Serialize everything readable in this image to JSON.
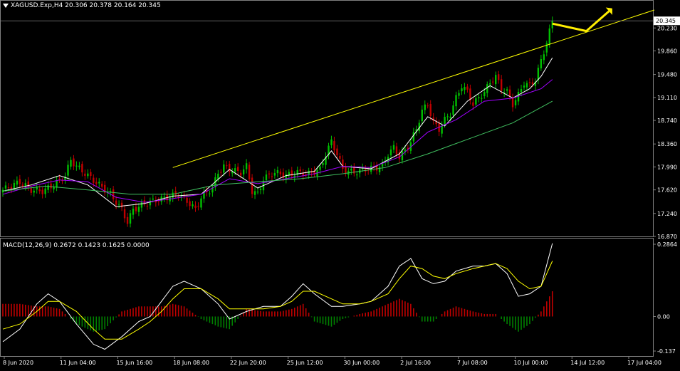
{
  "price_panel": {
    "symbol_line": "XAGUSD.Exp,H4  20.306 20.378 20.164 20.345",
    "last_price_label": "20.345"
  },
  "macd_panel": {
    "title": "MACD(12,26,9) 0.2672 0.1423 0.1625 0.0000"
  },
  "x_axis_labels": [
    "8 Jun 2020",
    "11 Jun 04:00",
    "15 Jun 16:00",
    "18 Jun 08:00",
    "22 Jun 20:00",
    "25 Jun 12:00",
    "30 Jun 00:00",
    "2 Jul 16:00",
    "7 Jul 08:00",
    "10 Jul 00:00",
    "14 Jul 12:00",
    "17 Jul 04:00"
  ],
  "colors": {
    "background": "#000000",
    "bull_candle": "#00c000",
    "bear_candle": "#c00000",
    "ma_fast": "#ffffff",
    "ma_mid": "#a000ff",
    "ma_slow": "#40c060",
    "trendline": "#ffff00",
    "arrow": "#ffee00",
    "macd_line": "#ffffff",
    "signal_line": "#ffff00",
    "hist_pos": "#c00000",
    "hist_neg": "#008000",
    "grid_text": "#ffffff"
  },
  "chart_data": [
    {
      "type": "candlestick",
      "title": "XAGUSD.Exp,H4",
      "ylim": [
        16.87,
        20.52
      ],
      "y_ticks": [
        "16.870",
        "17.240",
        "17.620",
        "17.990",
        "18.360",
        "18.740",
        "19.110",
        "19.480",
        "19.860",
        "20.230"
      ],
      "last_price": 20.345,
      "close_path": [
        [
          0,
          17.62
        ],
        [
          6,
          17.75
        ],
        [
          10,
          17.62
        ],
        [
          14,
          17.6
        ],
        [
          18,
          17.7
        ],
        [
          22,
          17.85
        ],
        [
          24,
          18.1
        ],
        [
          26,
          18.0
        ],
        [
          30,
          17.85
        ],
        [
          34,
          17.7
        ],
        [
          38,
          17.55
        ],
        [
          42,
          17.3
        ],
        [
          44,
          17.1
        ],
        [
          46,
          17.3
        ],
        [
          50,
          17.4
        ],
        [
          54,
          17.45
        ],
        [
          58,
          17.5
        ],
        [
          62,
          17.55
        ],
        [
          66,
          17.4
        ],
        [
          68,
          17.3
        ],
        [
          70,
          17.5
        ],
        [
          74,
          17.65
        ],
        [
          76,
          17.9
        ],
        [
          78,
          18.0
        ],
        [
          80,
          17.95
        ],
        [
          84,
          17.9
        ],
        [
          86,
          18.0
        ],
        [
          88,
          17.6
        ],
        [
          90,
          17.55
        ],
        [
          92,
          17.8
        ],
        [
          96,
          17.9
        ],
        [
          100,
          17.85
        ],
        [
          104,
          17.9
        ],
        [
          108,
          17.88
        ],
        [
          112,
          17.95
        ],
        [
          114,
          18.2
        ],
        [
          116,
          18.4
        ],
        [
          118,
          18.2
        ],
        [
          120,
          17.95
        ],
        [
          124,
          17.9
        ],
        [
          128,
          17.95
        ],
        [
          132,
          17.98
        ],
        [
          134,
          18.0
        ],
        [
          136,
          18.2
        ],
        [
          138,
          18.3
        ],
        [
          140,
          18.15
        ],
        [
          142,
          18.25
        ],
        [
          144,
          18.4
        ],
        [
          146,
          18.6
        ],
        [
          148,
          18.9
        ],
        [
          150,
          19.0
        ],
        [
          152,
          18.7
        ],
        [
          154,
          18.6
        ],
        [
          156,
          18.75
        ],
        [
          158,
          18.85
        ],
        [
          160,
          19.1
        ],
        [
          162,
          19.3
        ],
        [
          164,
          19.2
        ],
        [
          166,
          19.0
        ],
        [
          168,
          19.1
        ],
        [
          170,
          19.2
        ],
        [
          172,
          19.35
        ],
        [
          174,
          19.45
        ],
        [
          176,
          19.25
        ],
        [
          178,
          19.2
        ],
        [
          180,
          19.0
        ],
        [
          182,
          19.15
        ],
        [
          184,
          19.35
        ],
        [
          186,
          19.3
        ],
        [
          188,
          19.4
        ],
        [
          190,
          19.7
        ],
        [
          192,
          20.0
        ],
        [
          194,
          20.345
        ]
      ],
      "series": [
        {
          "name": "",
          "kind": "ma",
          "color": "#ffffff",
          "points": [
            [
              0,
              17.6
            ],
            [
              10,
              17.7
            ],
            [
              20,
              17.85
            ],
            [
              30,
              17.7
            ],
            [
              40,
              17.35
            ],
            [
              50,
              17.4
            ],
            [
              60,
              17.52
            ],
            [
              70,
              17.55
            ],
            [
              80,
              17.95
            ],
            [
              90,
              17.65
            ],
            [
              100,
              17.85
            ],
            [
              110,
              17.92
            ],
            [
              116,
              18.25
            ],
            [
              120,
              18.0
            ],
            [
              130,
              17.96
            ],
            [
              140,
              18.2
            ],
            [
              150,
              18.8
            ],
            [
              156,
              18.65
            ],
            [
              164,
              19.05
            ],
            [
              172,
              19.3
            ],
            [
              180,
              19.1
            ],
            [
              186,
              19.25
            ],
            [
              190,
              19.45
            ],
            [
              194,
              19.75
            ]
          ]
        },
        {
          "name": "",
          "kind": "ma",
          "color": "#a000ff",
          "points": [
            [
              0,
              17.55
            ],
            [
              10,
              17.68
            ],
            [
              20,
              17.78
            ],
            [
              30,
              17.75
            ],
            [
              40,
              17.5
            ],
            [
              50,
              17.42
            ],
            [
              60,
              17.48
            ],
            [
              70,
              17.55
            ],
            [
              80,
              17.8
            ],
            [
              90,
              17.72
            ],
            [
              100,
              17.8
            ],
            [
              110,
              17.88
            ],
            [
              120,
              18.0
            ],
            [
              130,
              17.98
            ],
            [
              140,
              18.15
            ],
            [
              150,
              18.55
            ],
            [
              160,
              18.75
            ],
            [
              170,
              19.05
            ],
            [
              180,
              19.1
            ],
            [
              190,
              19.25
            ],
            [
              194,
              19.4
            ]
          ]
        },
        {
          "name": "",
          "kind": "ma",
          "color": "#40c060",
          "points": [
            [
              0,
              17.6
            ],
            [
              15,
              17.68
            ],
            [
              30,
              17.62
            ],
            [
              45,
              17.55
            ],
            [
              60,
              17.55
            ],
            [
              75,
              17.7
            ],
            [
              90,
              17.75
            ],
            [
              105,
              17.8
            ],
            [
              120,
              17.88
            ],
            [
              135,
              17.98
            ],
            [
              150,
              18.2
            ],
            [
              165,
              18.45
            ],
            [
              180,
              18.7
            ],
            [
              194,
              19.05
            ]
          ]
        }
      ],
      "trendline": [
        [
          60,
          17.98
        ],
        [
          230,
          20.52
        ]
      ],
      "annotation_arrow": [
        [
          194,
          20.3
        ],
        [
          206,
          20.18
        ],
        [
          214,
          20.5
        ]
      ]
    },
    {
      "type": "bar",
      "title": "MACD(12,26,9)",
      "ylim": [
        -0.137,
        0.2864
      ],
      "y_ticks": [
        "0.2864",
        "0.00",
        "-0.137"
      ],
      "macd_line": [
        [
          0,
          -0.1
        ],
        [
          6,
          -0.05
        ],
        [
          12,
          0.05
        ],
        [
          16,
          0.09
        ],
        [
          20,
          0.06
        ],
        [
          26,
          -0.03
        ],
        [
          32,
          -0.11
        ],
        [
          36,
          -0.13
        ],
        [
          42,
          -0.08
        ],
        [
          48,
          -0.02
        ],
        [
          52,
          0.0
        ],
        [
          56,
          0.06
        ],
        [
          60,
          0.12
        ],
        [
          64,
          0.14
        ],
        [
          70,
          0.11
        ],
        [
          76,
          0.05
        ],
        [
          80,
          -0.01
        ],
        [
          86,
          0.02
        ],
        [
          92,
          0.04
        ],
        [
          98,
          0.04
        ],
        [
          102,
          0.08
        ],
        [
          106,
          0.13
        ],
        [
          110,
          0.09
        ],
        [
          116,
          0.04
        ],
        [
          120,
          0.04
        ],
        [
          126,
          0.05
        ],
        [
          130,
          0.06
        ],
        [
          136,
          0.12
        ],
        [
          140,
          0.2
        ],
        [
          144,
          0.23
        ],
        [
          148,
          0.15
        ],
        [
          152,
          0.13
        ],
        [
          156,
          0.14
        ],
        [
          160,
          0.18
        ],
        [
          166,
          0.2
        ],
        [
          170,
          0.2
        ],
        [
          174,
          0.21
        ],
        [
          178,
          0.17
        ],
        [
          182,
          0.08
        ],
        [
          186,
          0.09
        ],
        [
          190,
          0.12
        ],
        [
          194,
          0.29
        ]
      ],
      "signal_line": [
        [
          0,
          -0.05
        ],
        [
          6,
          -0.03
        ],
        [
          12,
          0.02
        ],
        [
          16,
          0.06
        ],
        [
          20,
          0.06
        ],
        [
          26,
          0.02
        ],
        [
          32,
          -0.05
        ],
        [
          36,
          -0.09
        ],
        [
          42,
          -0.09
        ],
        [
          48,
          -0.05
        ],
        [
          52,
          -0.02
        ],
        [
          56,
          0.02
        ],
        [
          60,
          0.07
        ],
        [
          64,
          0.11
        ],
        [
          70,
          0.11
        ],
        [
          76,
          0.07
        ],
        [
          80,
          0.03
        ],
        [
          86,
          0.03
        ],
        [
          92,
          0.03
        ],
        [
          98,
          0.04
        ],
        [
          102,
          0.06
        ],
        [
          106,
          0.1
        ],
        [
          110,
          0.1
        ],
        [
          116,
          0.07
        ],
        [
          120,
          0.05
        ],
        [
          126,
          0.05
        ],
        [
          130,
          0.06
        ],
        [
          136,
          0.09
        ],
        [
          140,
          0.15
        ],
        [
          144,
          0.2
        ],
        [
          148,
          0.19
        ],
        [
          152,
          0.16
        ],
        [
          156,
          0.15
        ],
        [
          160,
          0.17
        ],
        [
          166,
          0.19
        ],
        [
          170,
          0.2
        ],
        [
          174,
          0.21
        ],
        [
          178,
          0.19
        ],
        [
          182,
          0.14
        ],
        [
          186,
          0.11
        ],
        [
          190,
          0.12
        ],
        [
          194,
          0.22
        ]
      ],
      "histogram": [
        [
          0,
          0.05
        ],
        [
          6,
          0.05
        ],
        [
          12,
          0.04
        ],
        [
          16,
          0.04
        ],
        [
          20,
          0.03
        ],
        [
          26,
          -0.03
        ],
        [
          32,
          -0.06
        ],
        [
          36,
          -0.05
        ],
        [
          42,
          0.02
        ],
        [
          48,
          0.04
        ],
        [
          52,
          0.04
        ],
        [
          56,
          0.04
        ],
        [
          60,
          0.05
        ],
        [
          64,
          0.04
        ],
        [
          70,
          -0.01
        ],
        [
          76,
          -0.04
        ],
        [
          80,
          -0.05
        ],
        [
          86,
          0.03
        ],
        [
          92,
          0.02
        ],
        [
          98,
          0.02
        ],
        [
          102,
          0.03
        ],
        [
          106,
          0.05
        ],
        [
          110,
          -0.02
        ],
        [
          116,
          -0.04
        ],
        [
          120,
          -0.01
        ],
        [
          126,
          0.01
        ],
        [
          130,
          0.02
        ],
        [
          136,
          0.05
        ],
        [
          140,
          0.07
        ],
        [
          144,
          0.05
        ],
        [
          148,
          -0.02
        ],
        [
          152,
          -0.02
        ],
        [
          156,
          0.02
        ],
        [
          160,
          0.04
        ],
        [
          166,
          0.02
        ],
        [
          170,
          0.01
        ],
        [
          174,
          0.01
        ],
        [
          178,
          -0.03
        ],
        [
          182,
          -0.06
        ],
        [
          186,
          -0.03
        ],
        [
          190,
          0.02
        ],
        [
          194,
          0.1
        ]
      ]
    }
  ]
}
